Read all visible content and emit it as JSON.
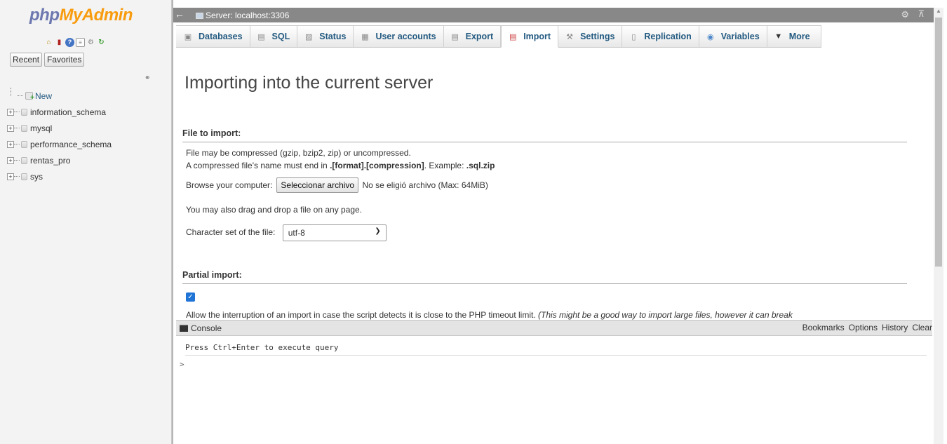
{
  "nav": {
    "logo_php": "php",
    "logo_myadmin": "MyAdmin",
    "icons": [
      "home-icon",
      "exit-icon",
      "help-icon",
      "docs-icon",
      "settings-icon",
      "reload-icon"
    ],
    "tabs": [
      "Recent",
      "Favorites"
    ],
    "new_label": "New",
    "databases": [
      "information_schema",
      "mysql",
      "performance_schema",
      "rentas_pro",
      "sys"
    ]
  },
  "topbar": {
    "server": "Server: localhost:3306"
  },
  "menu": {
    "tabs": [
      {
        "label": "Databases",
        "icon": "databases-icon"
      },
      {
        "label": "SQL",
        "icon": "sql-icon"
      },
      {
        "label": "Status",
        "icon": "status-icon"
      },
      {
        "label": "User accounts",
        "icon": "user-accounts-icon"
      },
      {
        "label": "Export",
        "icon": "export-icon"
      },
      {
        "label": "Import",
        "icon": "import-icon",
        "active": true
      },
      {
        "label": "Settings",
        "icon": "settings-icon"
      },
      {
        "label": "Replication",
        "icon": "replication-icon"
      },
      {
        "label": "Variables",
        "icon": "variables-icon"
      },
      {
        "label": "More",
        "icon": "more-caret-icon"
      }
    ]
  },
  "main": {
    "title": "Importing into the current server",
    "file_section": {
      "heading": "File to import:",
      "line1": "File may be compressed (gzip, bzip2, zip) or uncompressed.",
      "line2_pre": "A compressed file's name must end in ",
      "line2_bold1": ".[format].[compression]",
      "line2_mid": ". Example: ",
      "line2_bold2": ".sql.zip",
      "browse_label": "Browse your computer:",
      "browse_button": "Seleccionar archivo",
      "no_file": "No se eligió archivo",
      "max_size": "(Max: 64MiB)",
      "drag_hint": "You may also drag and drop a file on any page.",
      "charset_label": "Character set of the file:",
      "charset_value": "utf-8"
    },
    "partial_section": {
      "heading": "Partial import:",
      "checkbox_checked": true,
      "text": "Allow the interruption of an import in case the script detects it is close to the PHP timeout limit.",
      "text_italic": "(This might be a good way to import large files, however it can break"
    }
  },
  "console": {
    "title": "Console",
    "links": [
      "Bookmarks",
      "Options",
      "History",
      "Clear"
    ],
    "message": "Press Ctrl+Enter to execute query",
    "prompt": ">"
  }
}
